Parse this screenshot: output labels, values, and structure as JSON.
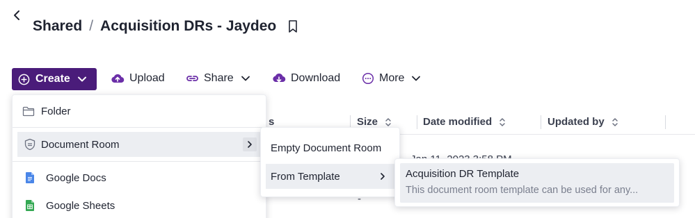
{
  "header": {
    "breadcrumb_root": "Shared",
    "separator": "/",
    "title": "Acquisition DRs - Jaydeo"
  },
  "toolbar": {
    "create_label": "Create",
    "upload_label": "Upload",
    "share_label": "Share",
    "download_label": "Download",
    "more_label": "More"
  },
  "table": {
    "columns": [
      "Size",
      "Date modified",
      "Updated by"
    ],
    "partial_first_column_char": "s",
    "row1_partial_date": "Jan 11, 2023 3:58 PM",
    "row2_size": "-"
  },
  "create_menu": {
    "items": [
      {
        "label": "Folder",
        "icon": "folder-icon"
      },
      {
        "label": "Document Room",
        "icon": "shield-icon"
      },
      {
        "label": "Google Docs",
        "icon": "google-docs-icon"
      },
      {
        "label": "Google Sheets",
        "icon": "google-sheets-icon"
      }
    ]
  },
  "document_room_menu": {
    "items": [
      {
        "label": "Empty Document Room"
      },
      {
        "label": "From Template"
      }
    ]
  },
  "template_menu": {
    "title": "Acquisition DR Template",
    "description": "This document room template can be used for any..."
  },
  "colors": {
    "accent": "#4a1c7a",
    "icon_purple": "#6b2fa8",
    "docs_blue": "#4a86e8",
    "sheets_green": "#34a853"
  }
}
